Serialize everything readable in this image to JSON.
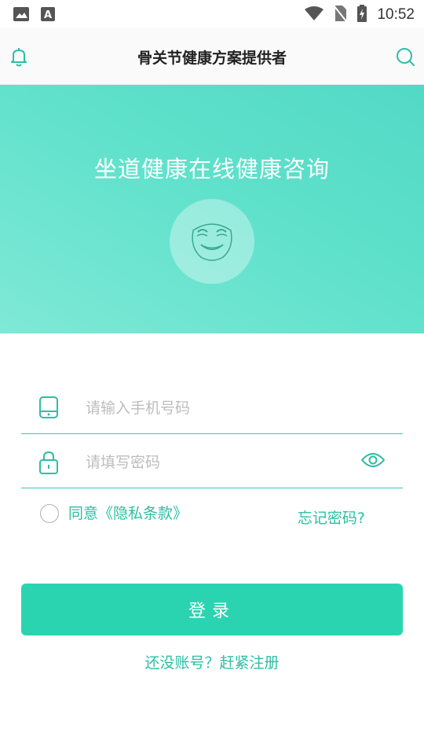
{
  "status_bar": {
    "time": "10:52",
    "icons": [
      "image-icon",
      "font-icon",
      "wifi-icon",
      "no-sim-icon",
      "battery-charging-icon"
    ]
  },
  "app_bar": {
    "title": "骨关节健康方案提供者",
    "left_icon": "bell-icon",
    "right_icon": "search-icon"
  },
  "hero": {
    "title": "坐道健康在线健康咨询",
    "avatar_icon": "smiling-face-icon"
  },
  "form": {
    "phone_placeholder": "请输入手机号码",
    "password_placeholder": "请填写密码",
    "agree_label": "同意《隐私条款》",
    "forgot_label": "忘记密码?",
    "login_label": "登录",
    "register_label": "还没账号？赶紧注册"
  },
  "colors": {
    "accent": "#2ad4b1",
    "accent_text": "#2cbfa3",
    "hero_gradient_start": "#7ee9d6",
    "hero_gradient_end": "#52d9c6"
  }
}
